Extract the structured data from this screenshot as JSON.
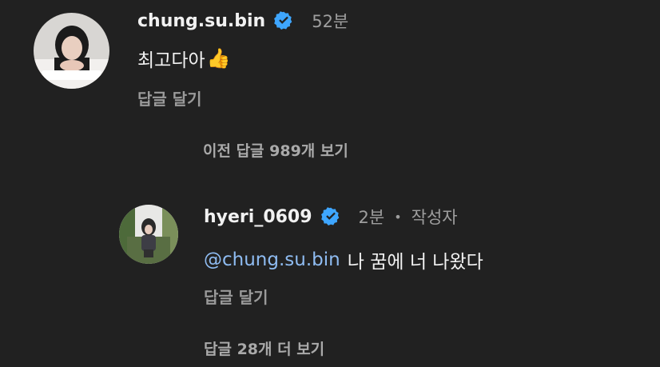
{
  "comment": {
    "username": "chung.su.bin",
    "time": "52분",
    "text": "최고다아",
    "emoji": "👍",
    "reply_label": "답글 달기"
  },
  "previous_replies_label": "이전 답글 989개 보기",
  "reply": {
    "username": "hyeri_0609",
    "time": "2분",
    "separator": "•",
    "author_tag": "작성자",
    "mention": "@chung.su.bin",
    "text": "나 꿈에 너 나왔다",
    "reply_label": "답글 달기"
  },
  "more_replies_label": "답글 28개 더 보기",
  "colors": {
    "background": "#212121",
    "verified_badge": "#3ea6ff",
    "mention": "#8fbcf2",
    "secondary_text": "#9e9e9e"
  },
  "icons": {
    "verified": "verified-check-icon",
    "emoji": "thumbs-up-emoji"
  }
}
